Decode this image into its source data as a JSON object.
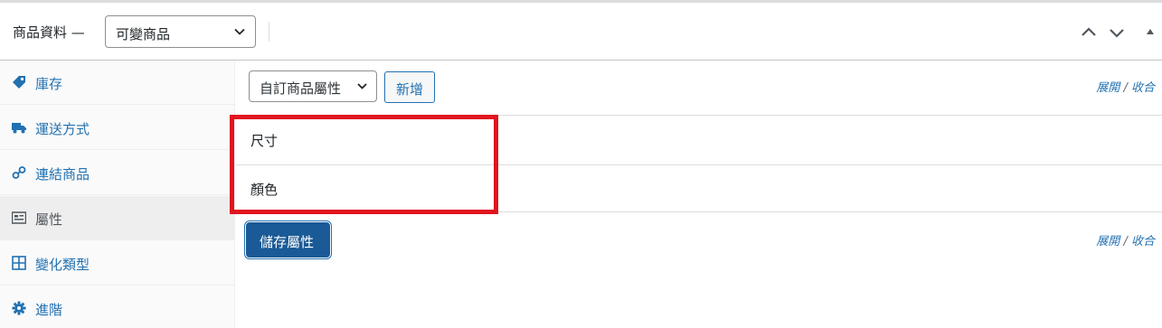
{
  "header": {
    "title": "商品資料 —",
    "product_type": "可變商品",
    "colors": {
      "border": "#c3c4c7",
      "accent": "#2271b1"
    }
  },
  "tabs": [
    {
      "label": "庫存",
      "icon": "tag-icon"
    },
    {
      "label": "運送方式",
      "icon": "truck-icon"
    },
    {
      "label": "連結商品",
      "icon": "link-icon"
    },
    {
      "label": "屬性",
      "icon": "list-icon",
      "active": true
    },
    {
      "label": "變化類型",
      "icon": "grid-icon"
    },
    {
      "label": "進階",
      "icon": "gear-icon"
    }
  ],
  "attributes": {
    "select_value": "自訂商品屬性",
    "add_label": "新增",
    "expand_label": "展開",
    "separator": "/",
    "collapse_label": "收合",
    "items": [
      "尺寸",
      "顏色"
    ],
    "save_label": "儲存屬性"
  },
  "annotation": {
    "highlight_color": "#e1141e"
  }
}
